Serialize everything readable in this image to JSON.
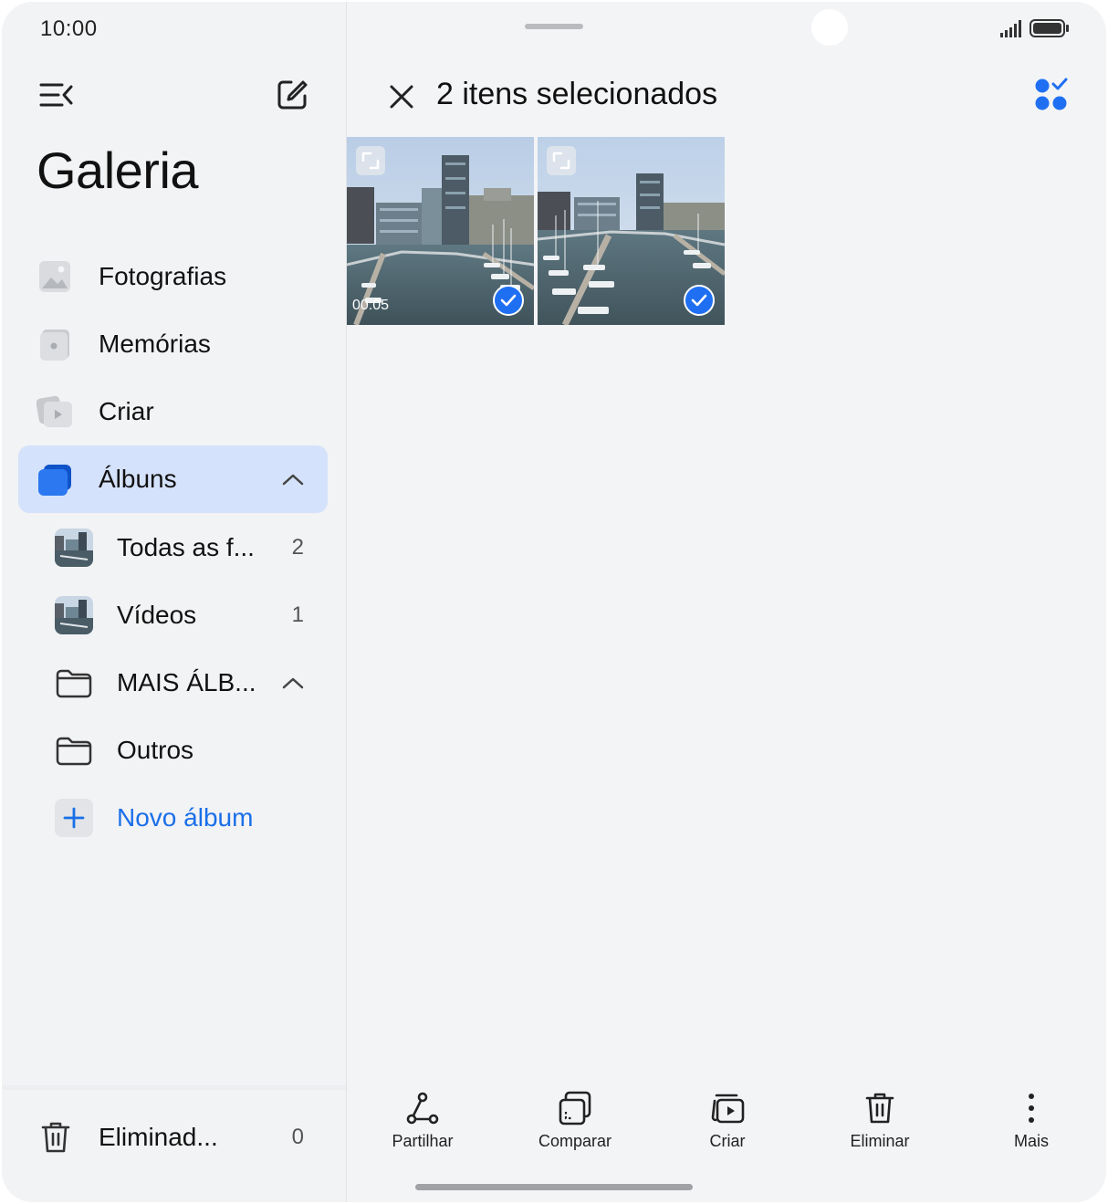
{
  "status_bar": {
    "time": "10:00"
  },
  "sidebar": {
    "title": "Galeria",
    "nav": [
      {
        "label": "Fotografias",
        "icon": "photo-icon"
      },
      {
        "label": "Memórias",
        "icon": "memories-icon"
      },
      {
        "label": "Criar",
        "icon": "create-icon"
      },
      {
        "label": "Álbuns",
        "icon": "albums-icon",
        "active": true,
        "expanded": true
      }
    ],
    "albums": [
      {
        "label": "Todas as f...",
        "count": "2"
      },
      {
        "label": "Vídeos",
        "count": "1"
      },
      {
        "label": "MAIS ÁLB...",
        "expanded": true
      },
      {
        "label": "Outros"
      }
    ],
    "new_album_label": "Novo álbum",
    "trash": {
      "label": "Eliminad...",
      "count": "0"
    }
  },
  "selection": {
    "title": "2 itens selecionados",
    "items": [
      {
        "duration": "00:05",
        "selected": true
      },
      {
        "selected": true
      }
    ]
  },
  "actions": [
    {
      "label": "Partilhar",
      "icon": "share-icon"
    },
    {
      "label": "Comparar",
      "icon": "compare-icon"
    },
    {
      "label": "Criar",
      "icon": "create-icon"
    },
    {
      "label": "Eliminar",
      "icon": "trash-icon"
    },
    {
      "label": "Mais",
      "icon": "more-vertical-icon"
    }
  ],
  "colors": {
    "accent": "#1f6ff2",
    "active_bg": "#d5e2fb",
    "background": "#f2f3f5"
  }
}
